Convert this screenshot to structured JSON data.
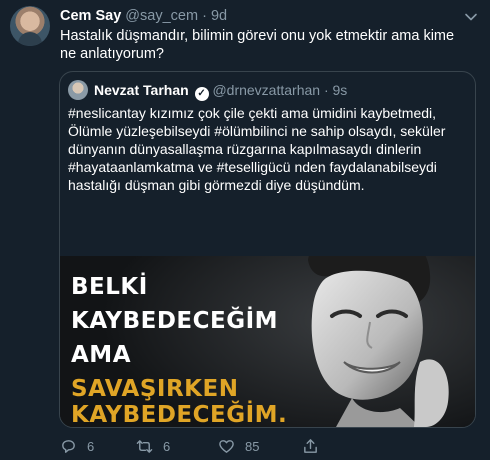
{
  "author": {
    "name": "Cem Say",
    "handle": "@say_cem",
    "separator": "·",
    "time": "9d"
  },
  "tweet_text": "Hastalık düşmandır, bilimin görevi onu yok etmektir ama kime ne anlatıyorum?",
  "quote": {
    "name": "Nevzat Tarhan",
    "handle": "@drnevzattarhan",
    "separator": "·",
    "time": "9s",
    "text": "#neslicantay kızımız çok çile çekti ama ümidini kaybetmedi, Ölümle yüzleşebilseydi #ölümbilinci ne sahip olsaydı, seküler dünyanın dünyasallaşma rüzgarına kapılmasaydı dinlerin #hayataanlamkatma ve #teselligücü nden faydalanabilseydi hastalığı düşman gibi görmezdi diye düşündüm.",
    "image_lines": [
      "BELKİ",
      "KAYBEDECEĞİM",
      "AMA",
      "SAVAŞIRKEN",
      "KAYBEDECEĞİM."
    ],
    "accent_color": "#e0a526"
  },
  "actions": {
    "reply_count": "6",
    "retweet_count": "6",
    "like_count": "85"
  },
  "colors": {
    "background": "#15202b",
    "muted": "#8899a6",
    "border": "#38444d"
  }
}
